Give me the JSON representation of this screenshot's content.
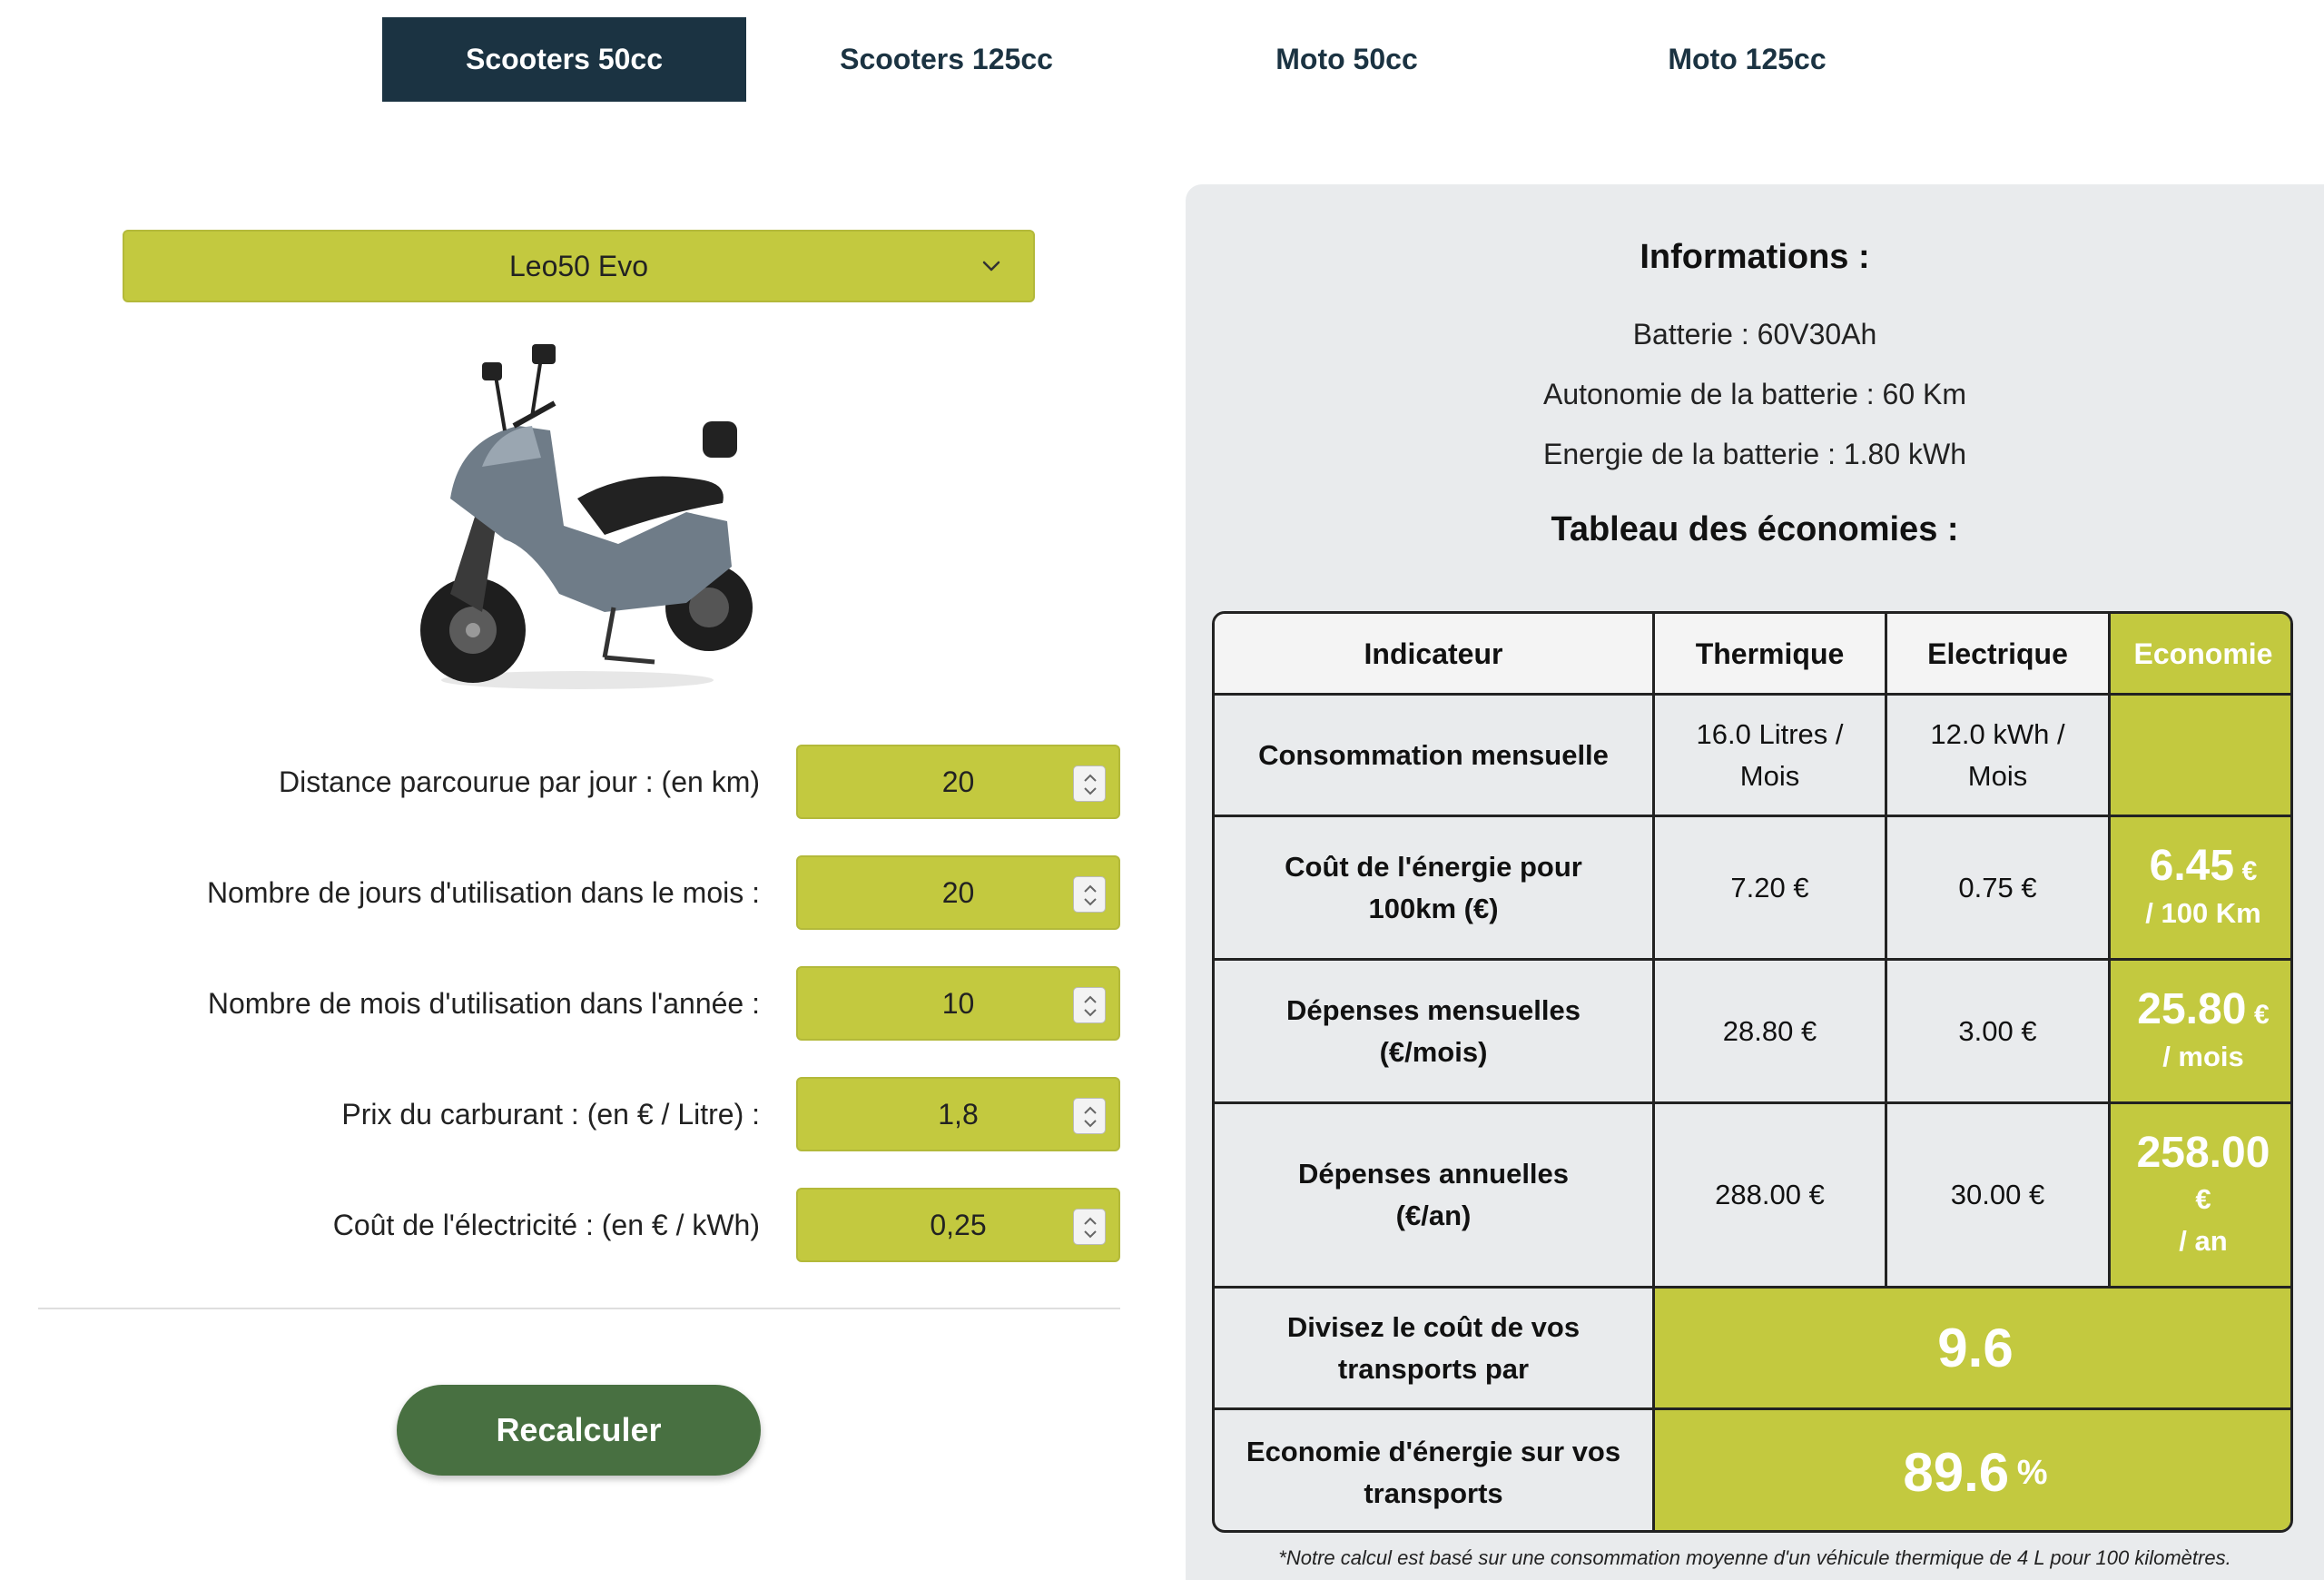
{
  "tabs": [
    {
      "label": "Scooters 50cc",
      "active": true
    },
    {
      "label": "Scooters 125cc",
      "active": false
    },
    {
      "label": "Moto 50cc",
      "active": false
    },
    {
      "label": "Moto 125cc",
      "active": false
    }
  ],
  "model_select": {
    "value": "Leo50 Evo"
  },
  "inputs": [
    {
      "label": "Distance parcourue par jour : (en km)",
      "value": "20"
    },
    {
      "label": "Nombre de jours d'utilisation dans le mois :",
      "value": "20"
    },
    {
      "label": "Nombre de mois d'utilisation dans l'année :",
      "value": "10"
    },
    {
      "label": "Prix du carburant : (en € / Litre) :",
      "value": "1,8"
    },
    {
      "label": "Coût de l'électricité : (en € / kWh)",
      "value": "0,25"
    }
  ],
  "recalc_label": "Recalculer",
  "info": {
    "title": "Informations :",
    "battery": "Batterie : 60V30Ah",
    "range": "Autonomie de la batterie : 60 Km",
    "energy": "Energie de la batterie : 1.80 kWh",
    "table_title": "Tableau des économies :"
  },
  "table": {
    "headers": [
      "Indicateur",
      "Thermique",
      "Electrique",
      "Economie"
    ],
    "rows": [
      {
        "indicator": "Consommation mensuelle",
        "thermique": "16.0 Litres / Mois",
        "electrique": "12.0 kWh / Mois",
        "eco_value": "",
        "eco_unit": "",
        "eco_suffix": ""
      },
      {
        "indicator": "Coût de l'énergie pour 100km (€)",
        "thermique": "7.20 €",
        "electrique": "0.75 €",
        "eco_value": "6.45",
        "eco_unit": "€",
        "eco_suffix": "/ 100 Km"
      },
      {
        "indicator": "Dépenses mensuelles (€/mois)",
        "thermique": "28.80 €",
        "electrique": "3.00 €",
        "eco_value": "25.80",
        "eco_unit": "€",
        "eco_suffix": "/ mois"
      },
      {
        "indicator": "Dépenses annuelles (€/an)",
        "thermique": "288.00 €",
        "electrique": "30.00 €",
        "eco_value": "258.00",
        "eco_unit": "€",
        "eco_suffix": "/ an"
      }
    ],
    "divide_label": "Divisez le coût de vos transports par",
    "divide_value": "9.6",
    "saving_label": "Economie d'énergie sur vos transports",
    "saving_value": "89.6",
    "saving_unit": "%"
  },
  "footnote": "*Notre calcul est basé sur une consommation moyenne d'un véhicule thermique de 4 L pour 100 kilomètres.",
  "colors": {
    "accent_green": "#c3c93f",
    "tab_active": "#1b3342",
    "button_green": "#487041",
    "panel_bg": "#e9ebed"
  }
}
